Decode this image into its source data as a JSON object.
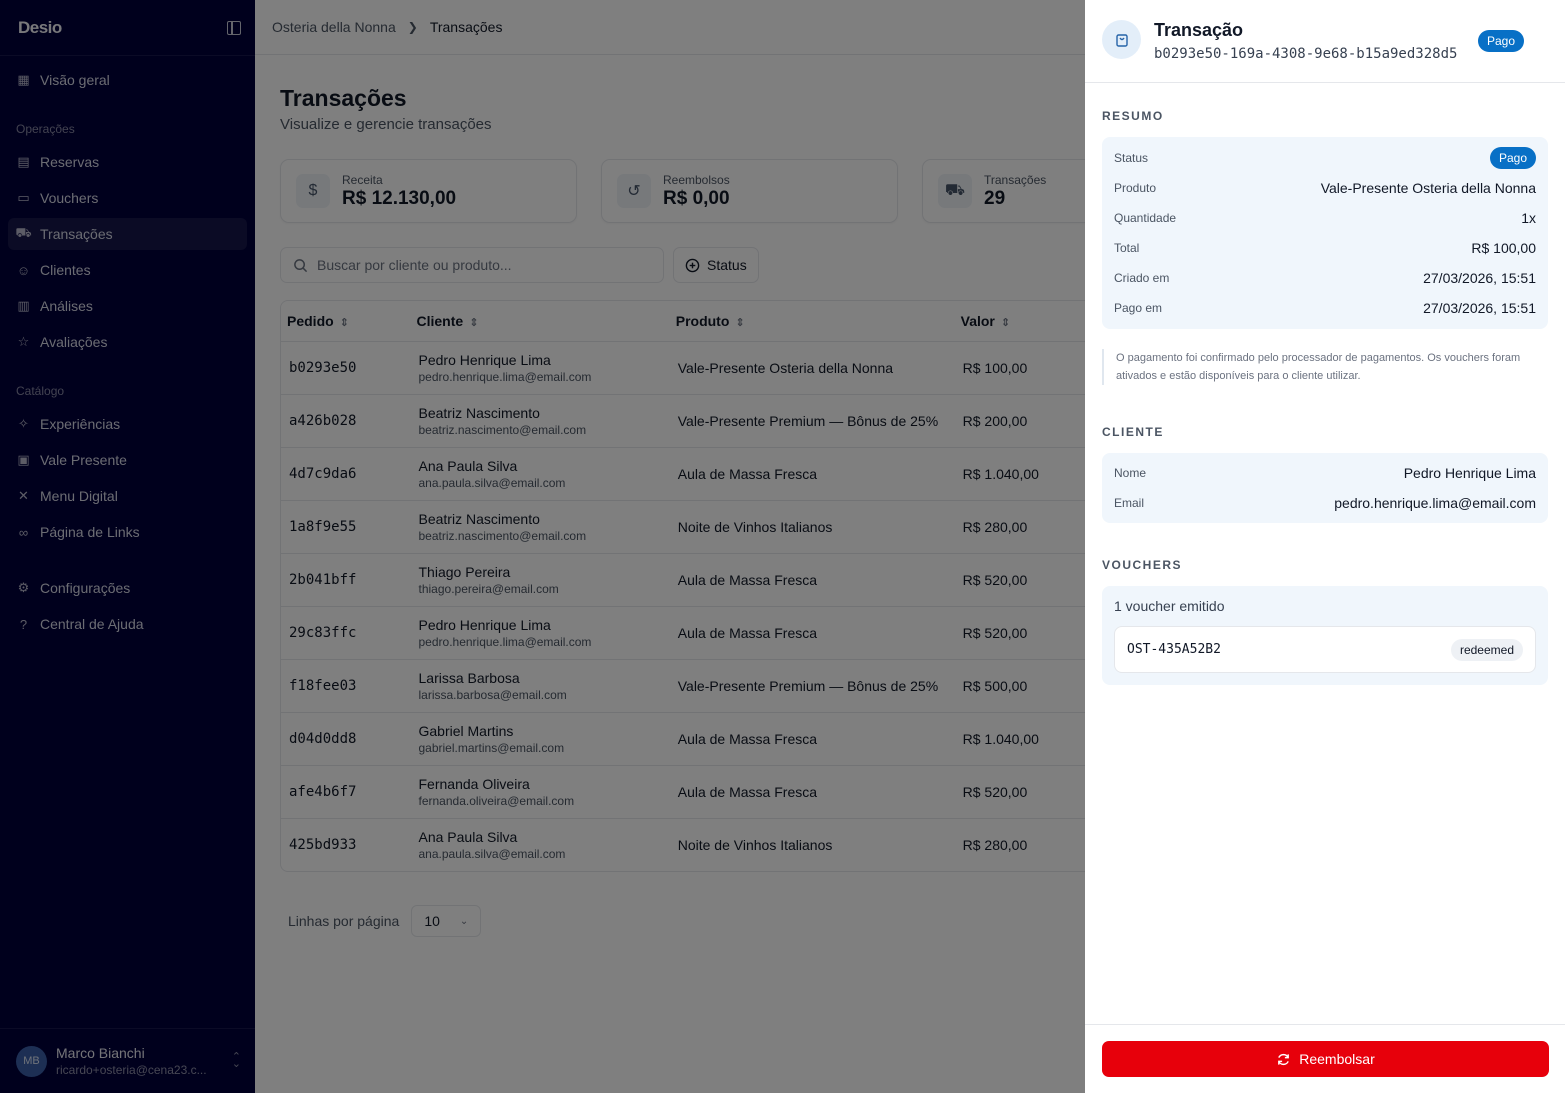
{
  "sidebar": {
    "logo": "Desio",
    "items_top": [
      {
        "label": "Visão geral",
        "icon": "dashboard-icon",
        "glyph": "▦"
      }
    ],
    "section_operacoes": "Operações",
    "items_ops": [
      {
        "label": "Reservas",
        "icon": "calendar-icon",
        "glyph": "▤"
      },
      {
        "label": "Vouchers",
        "icon": "ticket-icon",
        "glyph": "▭"
      },
      {
        "label": "Transações",
        "icon": "cart-icon",
        "glyph": "⛟"
      },
      {
        "label": "Clientes",
        "icon": "users-icon",
        "glyph": "☺"
      },
      {
        "label": "Análises",
        "icon": "bar-chart-icon",
        "glyph": "▥"
      },
      {
        "label": "Avaliações",
        "icon": "star-icon",
        "glyph": "☆"
      }
    ],
    "section_catalogo": "Catálogo",
    "items_cat": [
      {
        "label": "Experiências",
        "icon": "sparkles-icon",
        "glyph": "✧"
      },
      {
        "label": "Vale Presente",
        "icon": "gift-icon",
        "glyph": "▣"
      },
      {
        "label": "Menu Digital",
        "icon": "utensils-icon",
        "glyph": "✕"
      },
      {
        "label": "Página de Links",
        "icon": "link-icon",
        "glyph": "∞"
      }
    ],
    "items_bottom": [
      {
        "label": "Configurações",
        "icon": "gear-icon",
        "glyph": "⚙"
      },
      {
        "label": "Central de Ajuda",
        "icon": "help-icon",
        "glyph": "?"
      }
    ],
    "user": {
      "initials": "MB",
      "name": "Marco Bianchi",
      "email": "ricardo+osteria@cena23.c..."
    }
  },
  "breadcrumb": {
    "root": "Osteria della Nonna",
    "current": "Transações"
  },
  "page": {
    "title": "Transações",
    "subtitle": "Visualize e gerencie transações"
  },
  "stats": [
    {
      "label": "Receita",
      "value": "R$ 12.130,00",
      "icon": "dollar-icon",
      "glyph": "$"
    },
    {
      "label": "Reembolsos",
      "value": "R$ 0,00",
      "icon": "refresh-icon",
      "glyph": "↺"
    },
    {
      "label": "Transações",
      "value": "29",
      "icon": "cart-icon",
      "glyph": "⛟"
    }
  ],
  "filters": {
    "search_placeholder": "Buscar por cliente ou produto...",
    "status_label": "Status"
  },
  "table": {
    "headers": [
      "Pedido",
      "Cliente",
      "Produto",
      "Valor"
    ],
    "rows": [
      {
        "id": "b0293e50",
        "name": "Pedro Henrique Lima",
        "email": "pedro.henrique.lima@email.com",
        "product": "Vale-Presente Osteria della Nonna",
        "value": "R$ 100,00"
      },
      {
        "id": "a426b028",
        "name": "Beatriz Nascimento",
        "email": "beatriz.nascimento@email.com",
        "product": "Vale-Presente Premium — Bônus de 25%",
        "value": "R$ 200,00"
      },
      {
        "id": "4d7c9da6",
        "name": "Ana Paula Silva",
        "email": "ana.paula.silva@email.com",
        "product": "Aula de Massa Fresca",
        "value": "R$ 1.040,00"
      },
      {
        "id": "1a8f9e55",
        "name": "Beatriz Nascimento",
        "email": "beatriz.nascimento@email.com",
        "product": "Noite de Vinhos Italianos",
        "value": "R$ 280,00"
      },
      {
        "id": "2b041bff",
        "name": "Thiago Pereira",
        "email": "thiago.pereira@email.com",
        "product": "Aula de Massa Fresca",
        "value": "R$ 520,00"
      },
      {
        "id": "29c83ffc",
        "name": "Pedro Henrique Lima",
        "email": "pedro.henrique.lima@email.com",
        "product": "Aula de Massa Fresca",
        "value": "R$ 520,00"
      },
      {
        "id": "f18fee03",
        "name": "Larissa Barbosa",
        "email": "larissa.barbosa@email.com",
        "product": "Vale-Presente Premium — Bônus de 25%",
        "value": "R$ 500,00"
      },
      {
        "id": "d04d0dd8",
        "name": "Gabriel Martins",
        "email": "gabriel.martins@email.com",
        "product": "Aula de Massa Fresca",
        "value": "R$ 1.040,00"
      },
      {
        "id": "afe4b6f7",
        "name": "Fernanda Oliveira",
        "email": "fernanda.oliveira@email.com",
        "product": "Aula de Massa Fresca",
        "value": "R$ 520,00"
      },
      {
        "id": "425bd933",
        "name": "Ana Paula Silva",
        "email": "ana.paula.silva@email.com",
        "product": "Noite de Vinhos Italianos",
        "value": "R$ 280,00"
      }
    ]
  },
  "pager": {
    "label": "Linhas por página",
    "value": "10"
  },
  "panel": {
    "title": "Transação",
    "id": "b0293e50-169a-4308-9e68-b15a9ed328d5",
    "badge": "Pago",
    "resumo_label": "RESUMO",
    "resumo": [
      {
        "k": "Status",
        "v": "Pago",
        "badge": true
      },
      {
        "k": "Produto",
        "v": "Vale-Presente Osteria della Nonna"
      },
      {
        "k": "Quantidade",
        "v": "1x"
      },
      {
        "k": "Total",
        "v": "R$ 100,00"
      },
      {
        "k": "Criado em",
        "v": "27/03/2026, 15:51"
      },
      {
        "k": "Pago em",
        "v": "27/03/2026, 15:51"
      }
    ],
    "note": "O pagamento foi confirmado pelo processador de pagamentos. Os vouchers foram ativados e estão disponíveis para o cliente utilizar.",
    "cliente_label": "CLIENTE",
    "cliente": [
      {
        "k": "Nome",
        "v": "Pedro Henrique Lima"
      },
      {
        "k": "Email",
        "v": "pedro.henrique.lima@email.com"
      }
    ],
    "vouchers_label": "VOUCHERS",
    "voucher_count": "1 voucher emitido",
    "voucher": {
      "code": "OST-435A52B2",
      "status": "redeemed"
    },
    "refund_label": "Reembolsar"
  },
  "colors": {
    "sidebar_bg": "#01013a",
    "badge_blue": "#0870c6",
    "refund_red": "#e7000b"
  }
}
